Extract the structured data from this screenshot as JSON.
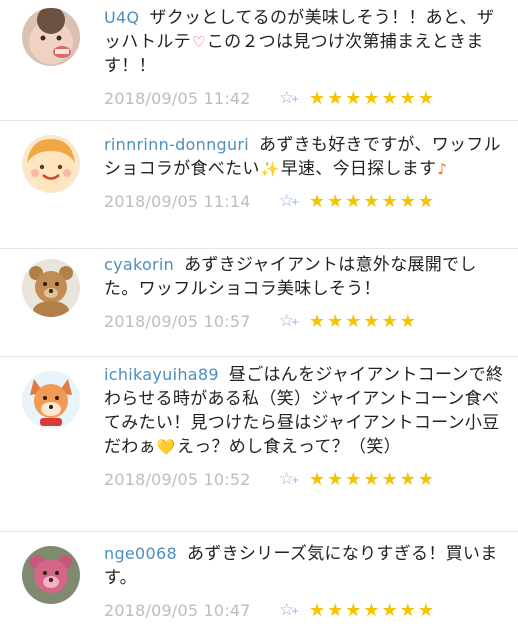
{
  "comments": [
    {
      "username": "U4Q",
      "text_parts": [
        "ザクッとしてるのが美味しそう！！あと、ザッハトルテ",
        "この２つは見つけ次第捕まえときます！！"
      ],
      "emoji": "♡",
      "timestamp": "2018/09/05 11:42",
      "rating": 7,
      "avatar": "baby-photo"
    },
    {
      "username": "rinnrinn-donnguri",
      "text_parts": [
        "あずきも好きですが、ワッフルショコラが食べたい",
        "早速、今日探します"
      ],
      "emoji": "✨",
      "emoji_end": "♪",
      "timestamp": "2018/09/05 11:14",
      "rating": 7,
      "avatar": "smiling-face"
    },
    {
      "username": "cyakorin",
      "text_parts": [
        "あずきジャイアントは意外な展開でした。ワッフルショコラ美味しそう！"
      ],
      "timestamp": "2018/09/05 10:57",
      "rating": 6,
      "avatar": "teddy-bear"
    },
    {
      "username": "ichikayuiha89",
      "text_parts": [
        "昼ごはんをジャイアントコーンで終わらせる時がある私（笑）ジャイアントコーン食べてみたい！見つけたら昼はジャイアントコーン小豆だわぁ",
        "えっ？めし食えって？（笑）"
      ],
      "emoji": "💛",
      "timestamp": "2018/09/05 10:52",
      "rating": 7,
      "avatar": "fox-character"
    },
    {
      "username": "nge0068",
      "text_parts": [
        "あずきシリーズ気になりすぎる！買います。"
      ],
      "timestamp": "2018/09/05 10:47",
      "rating": 7,
      "avatar": "pink-bear"
    }
  ],
  "colors": {
    "username": "#4a8fc0",
    "timestamp": "#bdbdbd",
    "star": "#f3c400",
    "fav_icon": "#8fb4dc"
  },
  "icons": {
    "fav": "star-plus-icon",
    "rating": "star-icon"
  }
}
